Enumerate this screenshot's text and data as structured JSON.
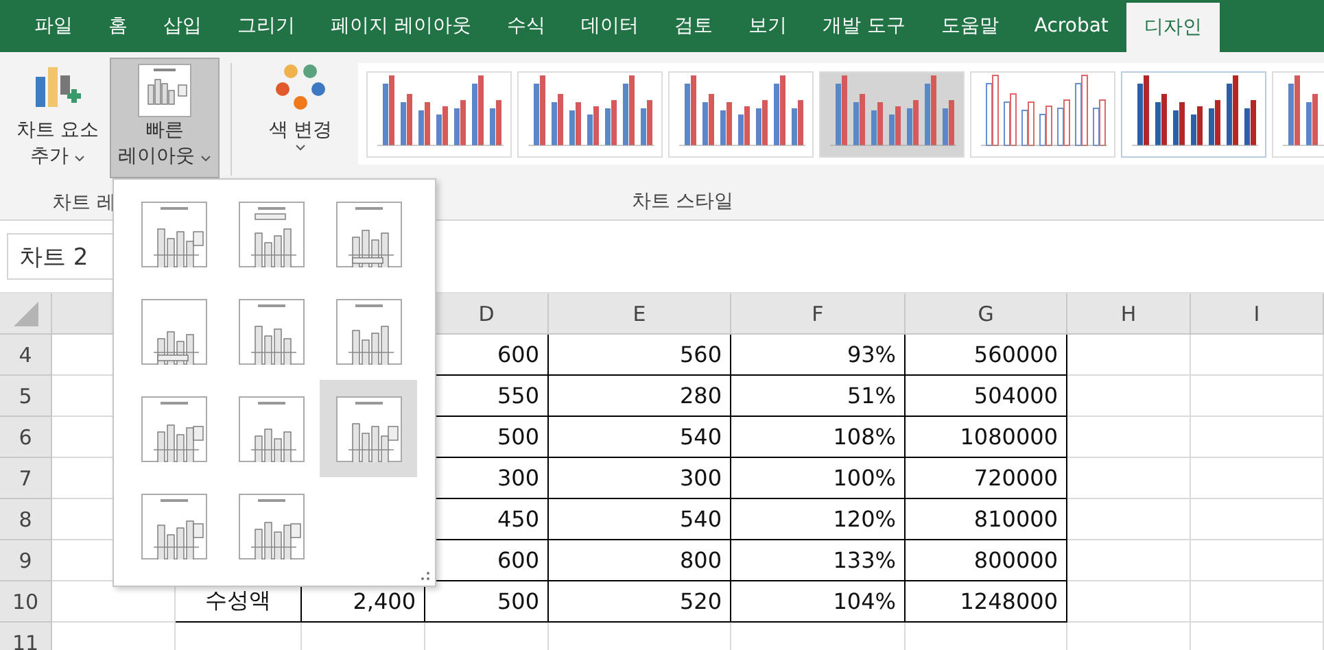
{
  "tabs": [
    {
      "label": "파일",
      "selected": false
    },
    {
      "label": "홈",
      "selected": false
    },
    {
      "label": "삽입",
      "selected": false
    },
    {
      "label": "그리기",
      "selected": false
    },
    {
      "label": "페이지 레이아웃",
      "selected": false
    },
    {
      "label": "수식",
      "selected": false
    },
    {
      "label": "데이터",
      "selected": false
    },
    {
      "label": "검토",
      "selected": false
    },
    {
      "label": "보기",
      "selected": false
    },
    {
      "label": "개발 도구",
      "selected": false
    },
    {
      "label": "도움말",
      "selected": false
    },
    {
      "label": "Acrobat",
      "selected": false
    },
    {
      "label": "디자인",
      "selected": true
    }
  ],
  "ribbon": {
    "buttons": [
      {
        "kind": "add-element",
        "lines": [
          "차트 요소",
          "추가"
        ],
        "pressed": false
      },
      {
        "kind": "quick-layout",
        "lines": [
          "빠른",
          "레이아웃"
        ],
        "pressed": true
      },
      {
        "kind": "colors",
        "lines": [
          "색 변경"
        ],
        "pressed": false
      }
    ],
    "group_labels": [
      "차트 레",
      "차트 스타일"
    ]
  },
  "name_box": {
    "value": "차트 2"
  },
  "quick_layouts": [
    {
      "selected": false
    },
    {
      "selected": false
    },
    {
      "selected": false
    },
    {
      "selected": false
    },
    {
      "selected": false
    },
    {
      "selected": false
    },
    {
      "selected": false
    },
    {
      "selected": false
    },
    {
      "selected": true
    },
    {
      "selected": false
    },
    {
      "selected": false
    }
  ],
  "sheet": {
    "column_headers": [
      "D",
      "E",
      "F",
      "G",
      "H",
      "I"
    ],
    "rows": [
      {
        "number": "4",
        "cells": {
          "D": "600",
          "E": "560",
          "F": "93%",
          "G": "560000"
        }
      },
      {
        "number": "5",
        "cells": {
          "D": "550",
          "E": "280",
          "F": "51%",
          "G": "504000"
        }
      },
      {
        "number": "6",
        "cells": {
          "D": "500",
          "E": "540",
          "F": "108%",
          "G": "1080000"
        }
      },
      {
        "number": "7",
        "cells": {
          "D": "300",
          "E": "300",
          "F": "100%",
          "G": "720000"
        }
      },
      {
        "number": "8",
        "cells": {
          "D": "450",
          "E": "540",
          "F": "120%",
          "G": "810000"
        }
      },
      {
        "number": "9",
        "cells": {
          "D": "600",
          "E": "800",
          "F": "133%",
          "G": "800000"
        }
      },
      {
        "number": "10",
        "cells": {
          "B": "수성액",
          "C": "2,400",
          "D": "500",
          "E": "520",
          "F": "104%",
          "G": "1248000"
        }
      },
      {
        "number": "11",
        "cells": {}
      }
    ]
  }
}
